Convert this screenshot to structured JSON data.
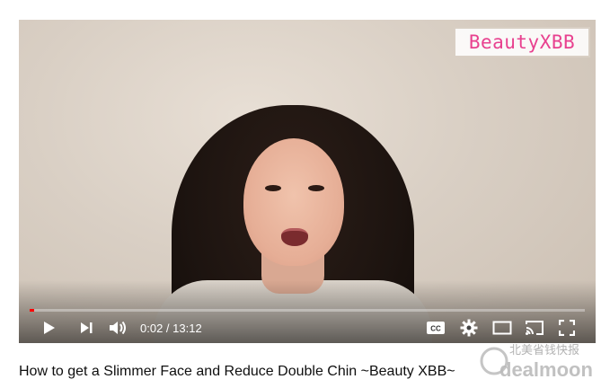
{
  "video": {
    "channel_logo_text": "BeautyXBB",
    "current_time": "0:02",
    "time_separator": " / ",
    "duration": "13:12",
    "progress_fraction": 0.0025
  },
  "controls": {
    "play_icon": "play-icon",
    "next_icon": "next-icon",
    "volume_icon": "volume-icon",
    "captions_icon": "captions-icon",
    "settings_icon": "gear-icon",
    "miniplayer_icon": "miniplayer-icon",
    "cast_icon": "cast-icon",
    "fullscreen_icon": "fullscreen-icon"
  },
  "page": {
    "video_title": "How to get a Slimmer Face and Reduce Double Chin ~Beauty XBB~"
  },
  "watermark": {
    "cjk_text": "北美省钱快报",
    "latin_text": "dealmoon"
  },
  "colors": {
    "progress": "#ff0000",
    "logo_text": "#e8418f"
  }
}
